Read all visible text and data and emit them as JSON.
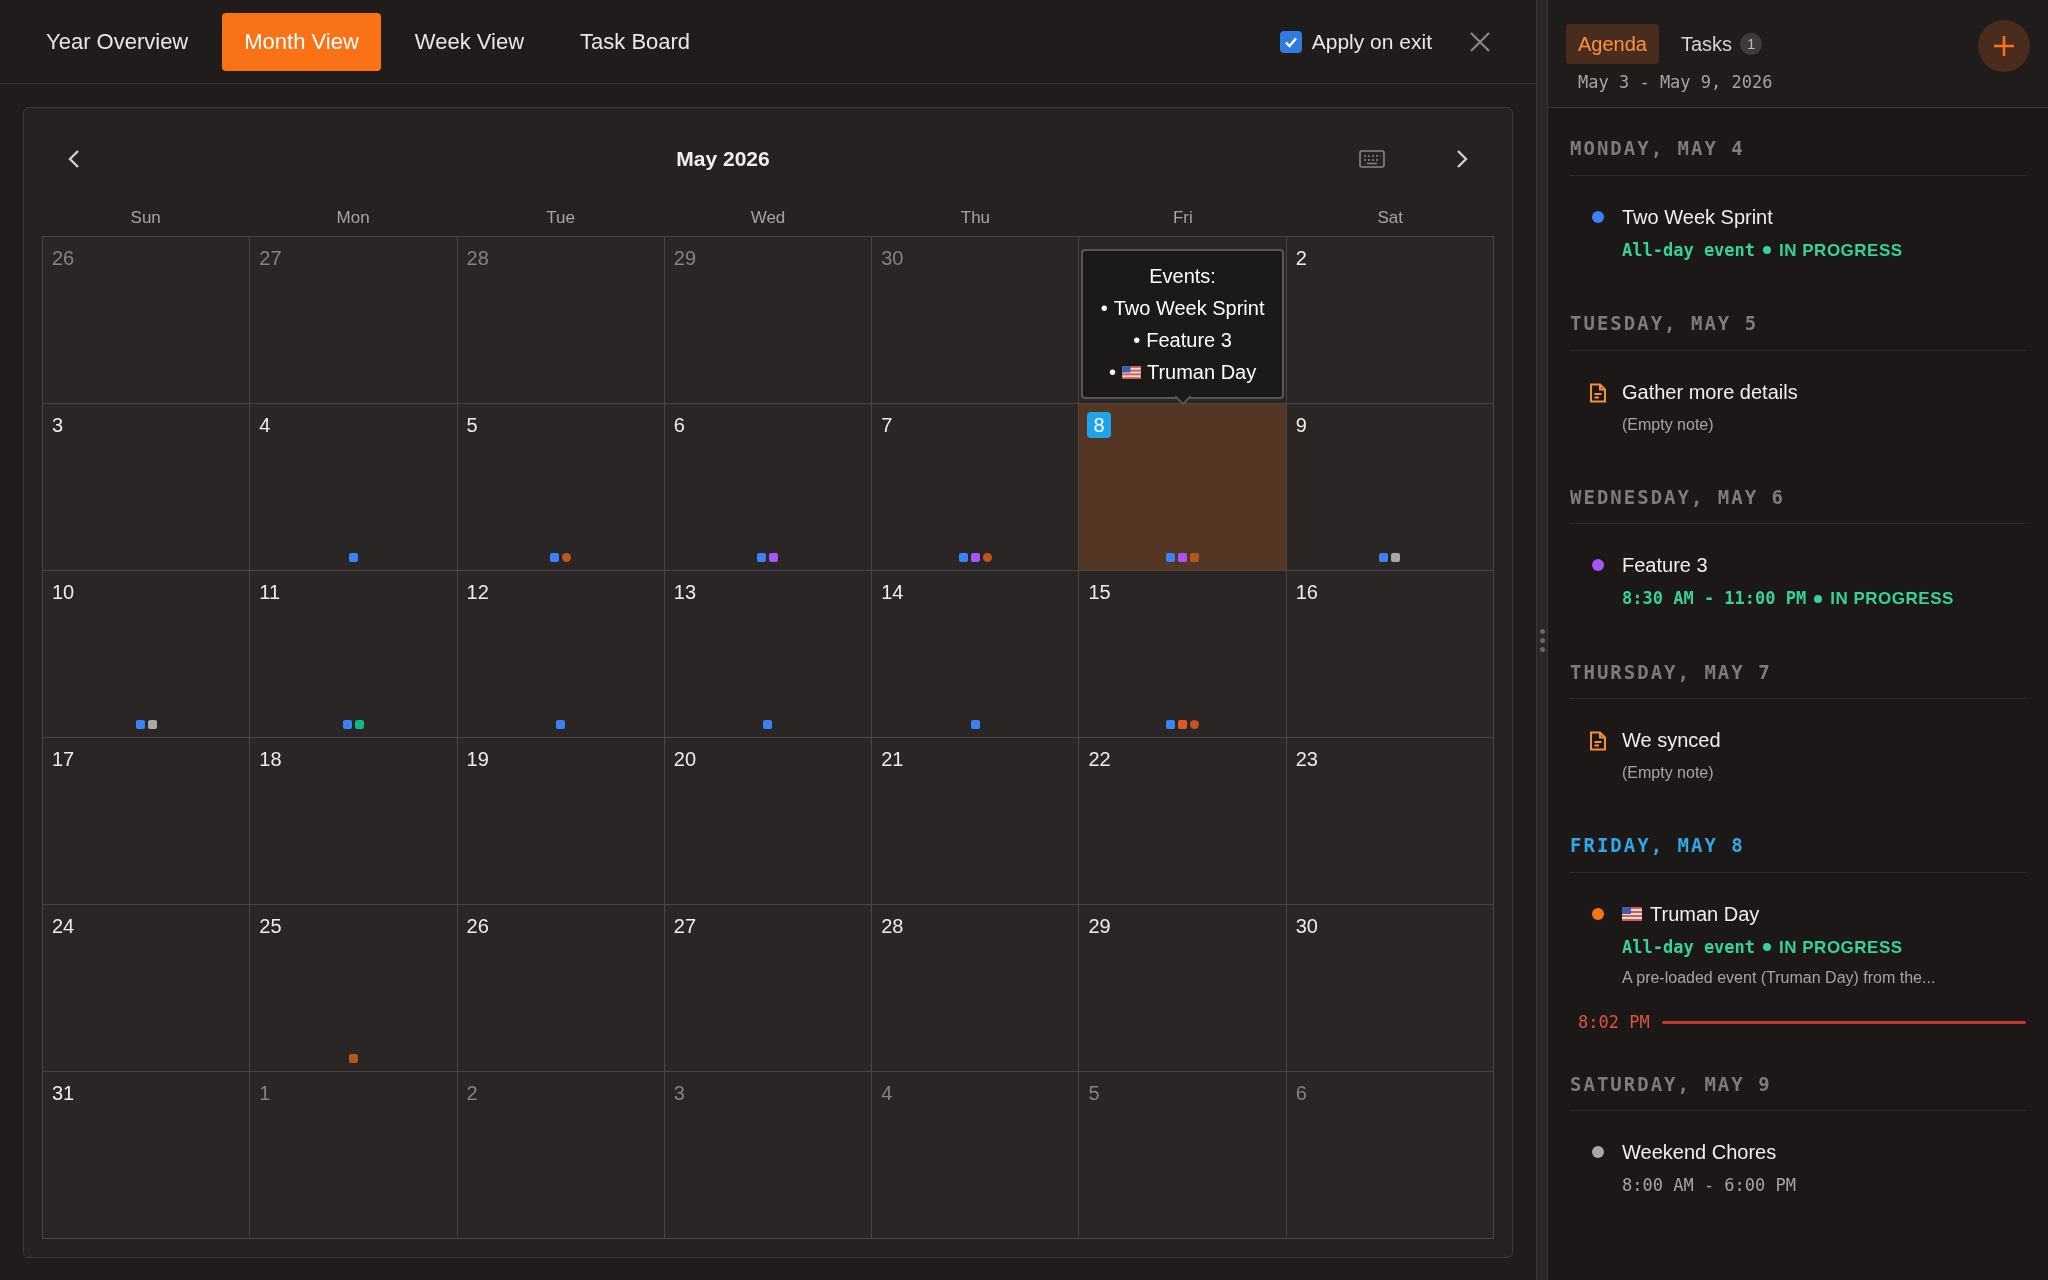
{
  "tabs": [
    {
      "label": "Year Overview",
      "selected": false
    },
    {
      "label": "Month View",
      "selected": true
    },
    {
      "label": "Week View",
      "selected": false
    },
    {
      "label": "Task Board",
      "selected": false
    }
  ],
  "apply_on_exit": {
    "label": "Apply on exit",
    "checked": true
  },
  "calendar": {
    "title": "May 2026",
    "weekdays": [
      "Sun",
      "Mon",
      "Tue",
      "Wed",
      "Thu",
      "Fri",
      "Sat"
    ],
    "weeks": [
      [
        {
          "day": "26",
          "in_month": false,
          "today": false
        },
        {
          "day": "27",
          "in_month": false,
          "today": false
        },
        {
          "day": "28",
          "in_month": false,
          "today": false
        },
        {
          "day": "29",
          "in_month": false,
          "today": false
        },
        {
          "day": "30",
          "in_month": false,
          "today": false
        },
        {
          "tooltip": {
            "title": "Events:",
            "items": [
              {
                "bullet": "•",
                "text": "Two Week Sprint",
                "flag": false
              },
              {
                "bullet": "•",
                "text": "Feature 3",
                "flag": false
              },
              {
                "bullet": "•",
                "text": "Truman Day",
                "flag": true
              }
            ]
          }
        },
        {
          "day": "2",
          "in_month": true,
          "today": false
        }
      ],
      [
        {
          "day": "3",
          "in_month": true,
          "today": false
        },
        {
          "day": "4",
          "in_month": true,
          "today": false,
          "dots": [
            {
              "color": "#3b82f6",
              "kind": "square"
            }
          ]
        },
        {
          "day": "5",
          "in_month": true,
          "today": false,
          "dots": [
            {
              "color": "#3b82f6",
              "kind": "square"
            },
            {
              "color": "#c2561f",
              "kind": "circle"
            }
          ]
        },
        {
          "day": "6",
          "in_month": true,
          "today": false,
          "dots": [
            {
              "color": "#3b82f6",
              "kind": "square"
            },
            {
              "color": "#a855f7",
              "kind": "square"
            }
          ]
        },
        {
          "day": "7",
          "in_month": true,
          "today": false,
          "dots": [
            {
              "color": "#3b82f6",
              "kind": "square"
            },
            {
              "color": "#a855f7",
              "kind": "square"
            },
            {
              "color": "#c2561f",
              "kind": "circle"
            }
          ]
        },
        {
          "day": "8",
          "in_month": true,
          "today": true,
          "dots": [
            {
              "color": "#3b82f6",
              "kind": "square"
            },
            {
              "color": "#a855f7",
              "kind": "square"
            },
            {
              "color": "#b5561f",
              "kind": "square"
            }
          ]
        },
        {
          "day": "9",
          "in_month": true,
          "today": false,
          "dots": [
            {
              "color": "#3b82f6",
              "kind": "square"
            },
            {
              "color": "#a8a8a8",
              "kind": "square"
            }
          ]
        }
      ],
      [
        {
          "day": "10",
          "in_month": true,
          "today": false,
          "dots": [
            {
              "color": "#3b82f6",
              "kind": "square"
            },
            {
              "color": "#a8a8a8",
              "kind": "square"
            }
          ]
        },
        {
          "day": "11",
          "in_month": true,
          "today": false,
          "dots": [
            {
              "color": "#3b82f6",
              "kind": "square"
            },
            {
              "color": "#10b981",
              "kind": "square"
            }
          ]
        },
        {
          "day": "12",
          "in_month": true,
          "today": false,
          "dots": [
            {
              "color": "#3b82f6",
              "kind": "square"
            }
          ]
        },
        {
          "day": "13",
          "in_month": true,
          "today": false,
          "dots": [
            {
              "color": "#3b82f6",
              "kind": "square"
            }
          ]
        },
        {
          "day": "14",
          "in_month": true,
          "today": false,
          "dots": [
            {
              "color": "#3b82f6",
              "kind": "square"
            }
          ]
        },
        {
          "day": "15",
          "in_month": true,
          "today": false,
          "dots": [
            {
              "color": "#3b82f6",
              "kind": "square"
            },
            {
              "color": "#dc5a1e",
              "kind": "square"
            },
            {
              "color": "#c2561f",
              "kind": "circle"
            }
          ]
        },
        {
          "day": "16",
          "in_month": true,
          "today": false
        }
      ],
      [
        {
          "day": "17",
          "in_month": true,
          "today": false
        },
        {
          "day": "18",
          "in_month": true,
          "today": false
        },
        {
          "day": "19",
          "in_month": true,
          "today": false
        },
        {
          "day": "20",
          "in_month": true,
          "today": false
        },
        {
          "day": "21",
          "in_month": true,
          "today": false
        },
        {
          "day": "22",
          "in_month": true,
          "today": false
        },
        {
          "day": "23",
          "in_month": true,
          "today": false
        }
      ],
      [
        {
          "day": "24",
          "in_month": true,
          "today": false
        },
        {
          "day": "25",
          "in_month": true,
          "today": false,
          "dots": [
            {
              "color": "#b5561f",
              "kind": "square"
            }
          ]
        },
        {
          "day": "26",
          "in_month": true,
          "today": false
        },
        {
          "day": "27",
          "in_month": true,
          "today": false
        },
        {
          "day": "28",
          "in_month": true,
          "today": false
        },
        {
          "day": "29",
          "in_month": true,
          "today": false
        },
        {
          "day": "30",
          "in_month": true,
          "today": false
        }
      ],
      [
        {
          "day": "31",
          "in_month": true,
          "today": false
        },
        {
          "day": "1",
          "in_month": false,
          "today": false
        },
        {
          "day": "2",
          "in_month": false,
          "today": false
        },
        {
          "day": "3",
          "in_month": false,
          "today": false
        },
        {
          "day": "4",
          "in_month": false,
          "today": false
        },
        {
          "day": "5",
          "in_month": false,
          "today": false
        },
        {
          "day": "6",
          "in_month": false,
          "today": false
        }
      ]
    ]
  },
  "panel": {
    "tabs": [
      {
        "label": "Agenda",
        "selected": true
      },
      {
        "label": "Tasks",
        "selected": false,
        "count": "1"
      }
    ],
    "range": "May 3 - May 9, 2026",
    "sections": [
      {
        "heading": "MONDAY, MAY 4",
        "today": false,
        "items": [
          {
            "kind": "event",
            "color": "#3b82f6",
            "title": "Two Week Sprint",
            "flag": false,
            "time": "All-day event",
            "status": "IN PROGRESS"
          }
        ]
      },
      {
        "heading": "TUESDAY, MAY 5",
        "today": false,
        "items": [
          {
            "kind": "note",
            "title": "Gather more details",
            "description": "(Empty note)"
          }
        ]
      },
      {
        "heading": "WEDNESDAY, MAY 6",
        "today": false,
        "items": [
          {
            "kind": "event",
            "color": "#a855f7",
            "title": "Feature 3",
            "flag": false,
            "time": "8:30 AM - 11:00 PM",
            "status": "IN PROGRESS"
          }
        ]
      },
      {
        "heading": "THURSDAY, MAY 7",
        "today": false,
        "items": [
          {
            "kind": "note",
            "title": "We synced",
            "description": "(Empty note)"
          }
        ]
      },
      {
        "heading": "FRIDAY, MAY 8",
        "today": true,
        "items": [
          {
            "kind": "event",
            "color": "#f97316",
            "title": "Truman Day",
            "flag": true,
            "time": "All-day event",
            "status": "IN PROGRESS",
            "description": "A pre-loaded event (Truman Day) from the..."
          }
        ],
        "now_line": "8:02 PM"
      },
      {
        "heading": "SATURDAY, MAY 9",
        "today": false,
        "items": [
          {
            "kind": "event",
            "color": "#a8a8a8",
            "title": "Weekend Chores",
            "flag": false,
            "time": "8:00 AM - 6:00 PM"
          }
        ]
      }
    ]
  }
}
